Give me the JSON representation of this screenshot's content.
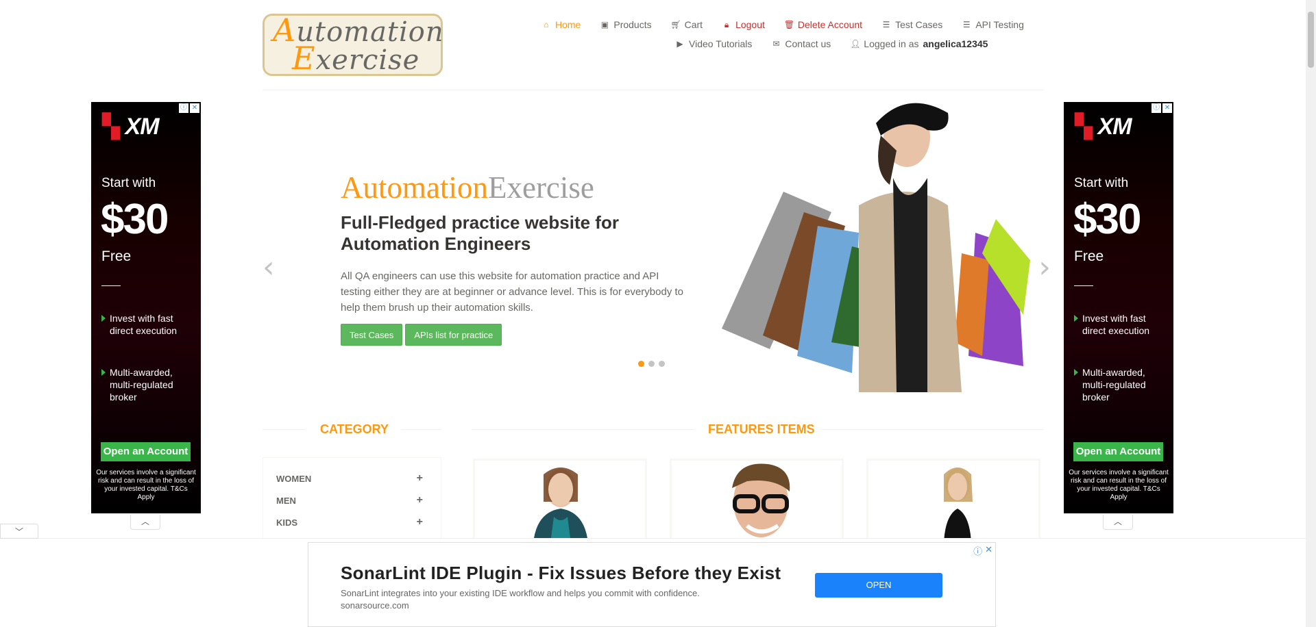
{
  "header": {
    "logo_line1": "utomation",
    "logo_cap1": "A",
    "logo_line2": "xercise",
    "logo_cap2": "E",
    "nav_row1": [
      {
        "label": "Home",
        "icon": "home-icon"
      },
      {
        "label": "Products",
        "icon": "products-icon"
      },
      {
        "label": "Cart",
        "icon": "cart-icon"
      },
      {
        "label": "Logout",
        "icon": "lock-icon"
      },
      {
        "label": "Delete Account",
        "icon": "trash-icon"
      },
      {
        "label": "Test Cases",
        "icon": "list-icon"
      },
      {
        "label": "API Testing",
        "icon": "list-icon"
      }
    ],
    "nav_row2": [
      {
        "label": "Video Tutorials",
        "icon": "youtube-icon"
      },
      {
        "label": "Contact us",
        "icon": "envelope-icon"
      }
    ],
    "logged_in_prefix": "Logged in as",
    "username": "angelica12345"
  },
  "side_ad": {
    "brand": "XM",
    "start": "Start with",
    "amount": "$30",
    "free": "Free",
    "bullet1": "Invest with fast direct execution",
    "bullet2": "Multi-awarded, multi-regulated broker",
    "cta": "Open an Account",
    "risk": "Our services involve a significant risk and can result in the loss of your invested capital. T&Cs Apply"
  },
  "slider": {
    "brand_a": "Automation",
    "brand_b": "Exercise",
    "headline": "Full-Fledged practice website for Automation Engineers",
    "description": "All QA engineers can use this website for automation practice and API testing either they are at beginner or advance level. This is for everybody to help them brush up their automation skills.",
    "btn_test_cases": "Test Cases",
    "btn_apis": "APIs list for practice",
    "active_slide": 1,
    "slide_count": 3
  },
  "category": {
    "title": "CATEGORY",
    "items": [
      "WOMEN",
      "MEN",
      "KIDS"
    ]
  },
  "features": {
    "title": "FEATURES ITEMS"
  },
  "bottom_ad": {
    "title": "SonarLint IDE Plugin - Fix Issues Before they Exist",
    "description": "SonarLint integrates into your existing IDE workflow and helps you commit with confidence.",
    "domain": "sonarsource.com",
    "button": "OPEN"
  },
  "colors": {
    "accent": "#FE980F",
    "green": "#5cb85c",
    "danger": "#c9302c",
    "ad_blue": "#1a82fb"
  }
}
